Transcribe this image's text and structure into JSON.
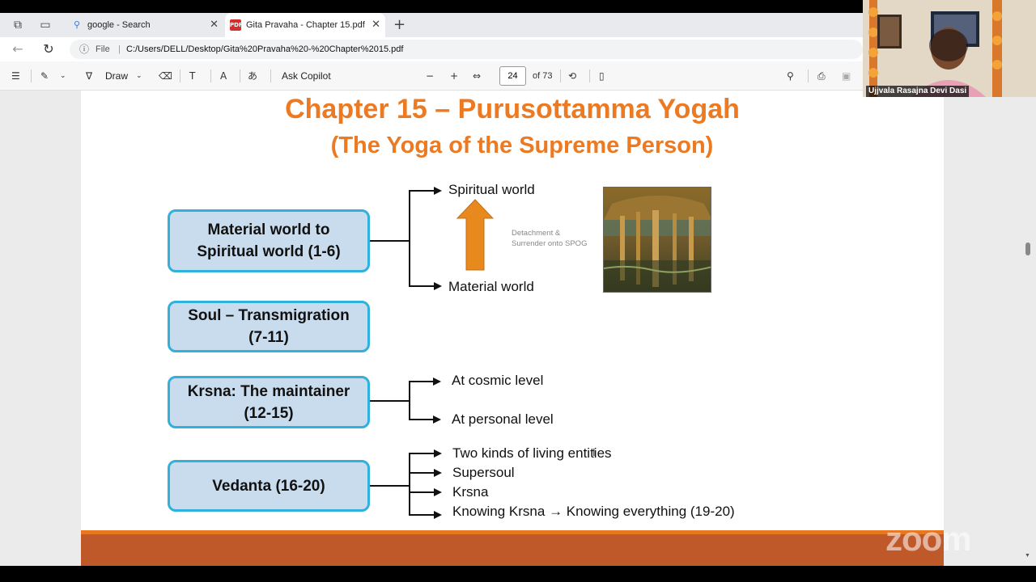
{
  "tabs": [
    {
      "title": "google - Search",
      "icon": "search-icon"
    },
    {
      "title": "Gita Pravaha - Chapter 15.pdf",
      "icon": "pdf-icon"
    }
  ],
  "address": {
    "scheme": "File",
    "url": "C:/Users/DELL/Desktop/Gita%20Pravaha%20-%20Chapter%2015.pdf"
  },
  "pdf_toolbar": {
    "draw_label": "Draw",
    "ask_copilot_label": "Ask Copilot",
    "page_number": "24",
    "page_total": "of 73"
  },
  "slide": {
    "title": "Chapter 15 – Purusottamma Yogah",
    "subtitle": "(The Yoga of the Supreme Person)",
    "sections": [
      {
        "label": "Material world to\nSpiritual world (1-6)",
        "branches": [
          "Spiritual world",
          "Material world"
        ]
      },
      {
        "label": "Soul – Transmigration\n(7-11)",
        "branches": []
      },
      {
        "label": "Krsna: The maintainer\n(12-15)",
        "branches": [
          "At cosmic level",
          "At personal level"
        ]
      },
      {
        "label": "Vedanta (16-20)",
        "branches": [
          "Two kinds of living entities",
          "Supersoul",
          "Krsna",
          "Knowing Krsna → Knowing everything (19-20)"
        ]
      }
    ],
    "arrow_note": "Detachment &\nSurrender onto SPOG"
  },
  "video": {
    "participant_name": "Ujjvala Rasajna Devi Dasi"
  },
  "zoom_watermark": "zoom",
  "colors": {
    "title": "#ec7a22",
    "box_fill": "#c9dcee",
    "box_border": "#2fb1dc",
    "footer": "#c0592a",
    "arrow": "#e8891e"
  }
}
